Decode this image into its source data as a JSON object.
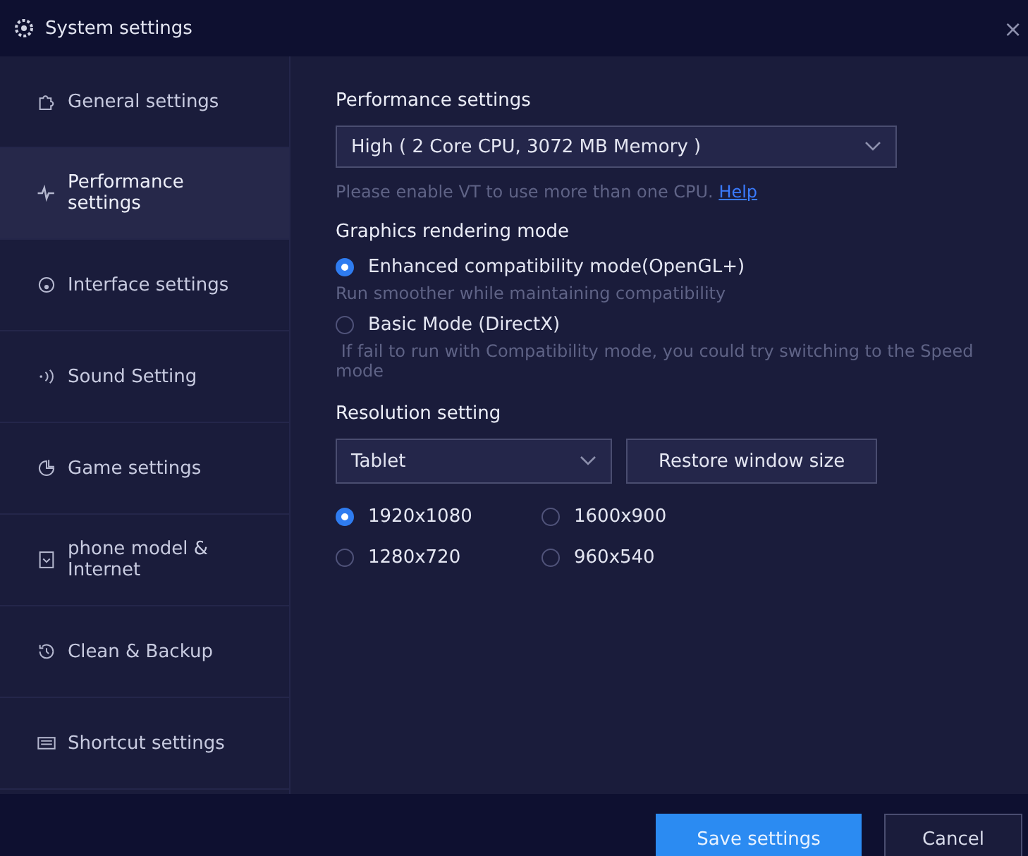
{
  "window": {
    "title": "System settings",
    "close": "×"
  },
  "sidebar": {
    "items": [
      {
        "label": "General settings",
        "selected": false
      },
      {
        "label": "Performance settings",
        "selected": true
      },
      {
        "label": "Interface settings",
        "selected": false
      },
      {
        "label": "Sound Setting",
        "selected": false
      },
      {
        "label": "Game settings",
        "selected": false
      },
      {
        "label": "phone model & Internet",
        "selected": false
      },
      {
        "label": "Clean & Backup",
        "selected": false
      },
      {
        "label": "Shortcut settings",
        "selected": false
      }
    ]
  },
  "sections": [
    {
      "kind": "performance",
      "title": "Performance settings",
      "dropdown": {
        "value": "High ( 2 Core CPU, 3072 MB Memory )"
      },
      "hint": "Please enable VT to use more than one CPU.",
      "link": "Help"
    },
    {
      "kind": "graphics",
      "title": "Graphics rendering mode",
      "options": [
        {
          "label": "Enhanced compatibility mode(OpenGL+)",
          "selected": true,
          "description": "Run smoother while maintaining compatibility"
        },
        {
          "label": "Basic Mode (DirectX)",
          "selected": false,
          "description": " If fail to run with Compatibility mode, you could try switching to the Speed mode"
        }
      ]
    },
    {
      "kind": "resolution",
      "title": "Resolution setting",
      "dropdown": {
        "value": "Tablet"
      },
      "button": "Restore window size",
      "options": [
        {
          "label": "1920x1080",
          "selected": true
        },
        {
          "label": "1600x900",
          "selected": false
        },
        {
          "label": "1280x720",
          "selected": false
        },
        {
          "label": "960x540",
          "selected": false
        }
      ]
    }
  ],
  "footer": {
    "buttons": [
      {
        "label": "Save settings",
        "kind": "primary"
      },
      {
        "label": "Cancel",
        "kind": "secondary"
      }
    ]
  }
}
